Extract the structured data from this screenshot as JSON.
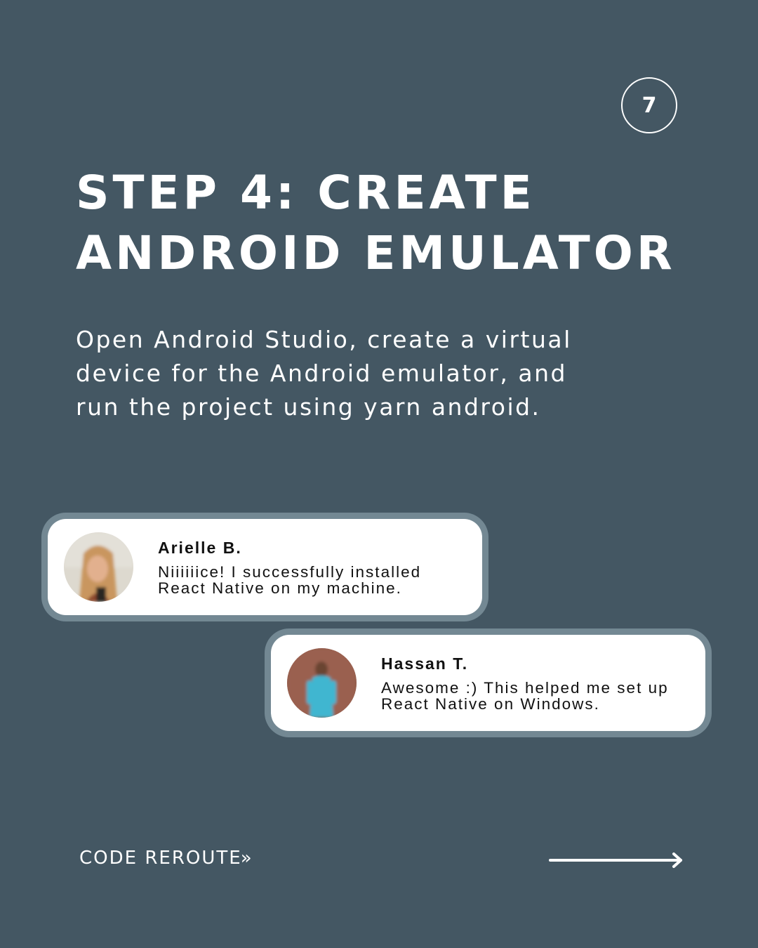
{
  "page_number": "7",
  "title_lines": [
    "STEP 4: CREATE",
    "ANDROID EMULATOR"
  ],
  "description_lines": [
    "Open Android Studio, create a virtual",
    "device for the Android emulator, and",
    "run the project using yarn android."
  ],
  "reviews": [
    {
      "name": "Arielle B.",
      "text_lines": [
        "Niiiiiice! I successfully installed",
        "React Native on my machine."
      ]
    },
    {
      "name": "Hassan T.",
      "text_lines": [
        "Awesome :) This helped me set up",
        "React Native on Windows."
      ]
    }
  ],
  "brand": "CODE REROUTE",
  "brand_icon": "double-chevron-right-icon",
  "next_icon": "arrow-right-icon",
  "colors": {
    "background": "#445763",
    "card_border": "#738893",
    "card_background": "#ffffff",
    "text_light": "#ffffff",
    "text_dark": "#111111"
  }
}
